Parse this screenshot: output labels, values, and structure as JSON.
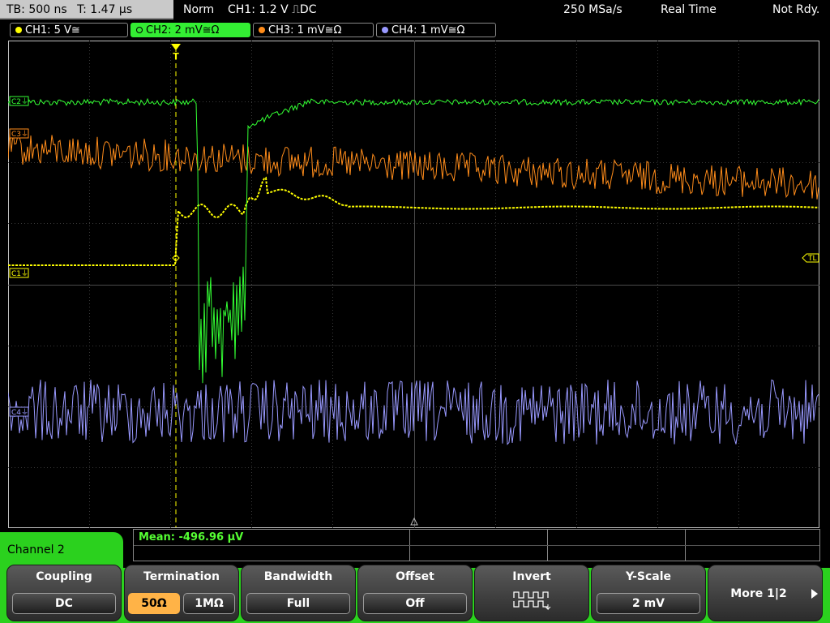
{
  "topbar": {
    "timebase": "TB: 500 ns",
    "trigger_time": "T: 1.47 µs",
    "mode": "Norm",
    "trigger": "CH1: 1.2 V ⎍DC",
    "sample_rate": "250 MSa/s",
    "acq": "Real Time",
    "status": "Not Rdy."
  },
  "channels": [
    {
      "label": "CH1: 5 V≅",
      "color": "#ffff00",
      "active": false
    },
    {
      "label": "CH2: 2 mV≅Ω",
      "color": "#33ff33",
      "active": true
    },
    {
      "label": "CH3: 1 mV≅Ω",
      "color": "#ff8c1a",
      "active": false
    },
    {
      "label": "CH4: 1 mV≅Ω",
      "color": "#9999ff",
      "active": false
    }
  ],
  "markers": {
    "c1": "C1⏚",
    "c2": "C2⏚",
    "c3": "C3⏚",
    "c4": "C4⏚",
    "trigger_level": "TL",
    "trigger_pos": "T"
  },
  "measurement": {
    "label": "Mean: -496.96 µV"
  },
  "menu": {
    "title": "Channel 2",
    "coupling": {
      "title": "Coupling",
      "value": "DC"
    },
    "termination": {
      "title": "Termination",
      "opt1": "50Ω",
      "opt2": "1MΩ"
    },
    "bandwidth": {
      "title": "Bandwidth",
      "value": "Full"
    },
    "offset": {
      "title": "Offset",
      "value": "Off"
    },
    "invert": {
      "title": "Invert"
    },
    "yscale": {
      "title": "Y-Scale",
      "value": "2 mV"
    },
    "more": {
      "label": "More 1|2"
    }
  },
  "colors": {
    "ch1": "#ffff00",
    "ch2": "#33ff33",
    "ch3": "#ff8c1a",
    "ch4": "#9999ff",
    "accent": "#2bd11e",
    "selected": "#ffb347"
  }
}
